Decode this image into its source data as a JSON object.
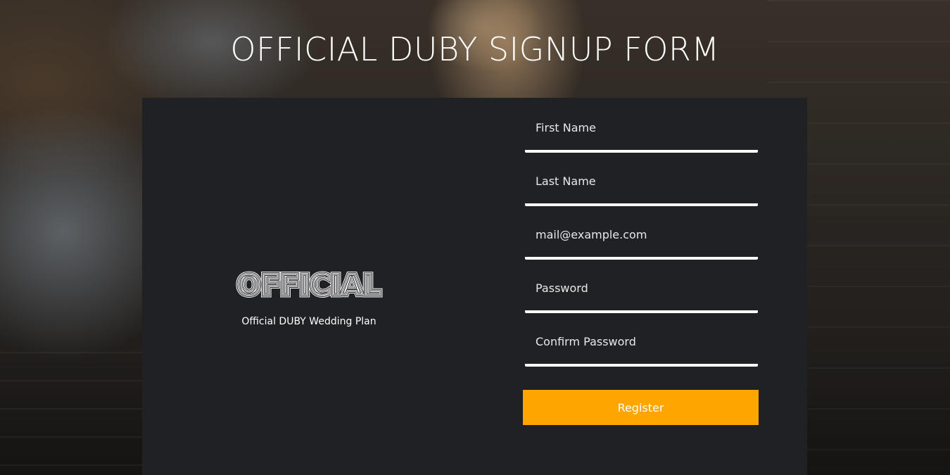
{
  "header": {
    "title": "OFFICIAL DUBY SIGNUP FORM"
  },
  "brand": {
    "logo_text": "OFFICIAL",
    "tagline": "Official DUBY Wedding Plan"
  },
  "form": {
    "first_name_placeholder": "First Name",
    "last_name_placeholder": "Last Name",
    "email_placeholder": "mail@example.com",
    "password_placeholder": "Password",
    "confirm_password_placeholder": "Confirm Password",
    "register_label": "Register"
  },
  "colors": {
    "card_background": "#202124",
    "accent": "#ffa500",
    "text": "#ffffff"
  }
}
